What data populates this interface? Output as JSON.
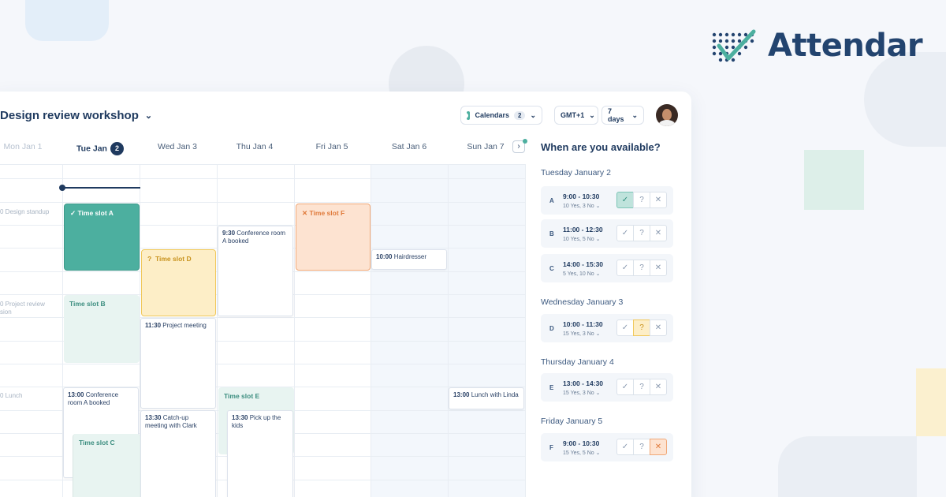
{
  "brand": {
    "name": "Attendar",
    "colors": {
      "primary": "#23446f",
      "accent": "#4caf9f"
    }
  },
  "header": {
    "title": "Design review workshop",
    "calendars_label": "Calendars",
    "calendars_count": "2",
    "timezone": "GMT+1",
    "range": "7 days"
  },
  "days": [
    {
      "label": "Mon Jan 1"
    },
    {
      "label": "Tue Jan",
      "badge": "2"
    },
    {
      "label": "Wed Jan 3"
    },
    {
      "label": "Thu Jan 4"
    },
    {
      "label": "Fri Jan 5"
    },
    {
      "label": "Sat Jan 6"
    },
    {
      "label": "Sun Jan 7"
    }
  ],
  "events": {
    "design_standup": "Design standup",
    "project_review": "Project review",
    "project_review_2": "sion",
    "lunch": "Lunch",
    "conf_room_tue_time": "13:00",
    "conf_room_tue": "Conference room A booked",
    "conf_room_thu_time": "9:30",
    "conf_room_thu": "Conference room A booked",
    "project_meeting_time": "11:30",
    "project_meeting": "Project meeting",
    "catchup_time": "13:30",
    "catchup": "Catch-up meeting with Clark",
    "pickup_time": "13:30",
    "pickup": "Pick up the kids",
    "hairdresser_time": "10:00",
    "hairdresser": "Hairdresser",
    "lunch_linda_time": "13:00",
    "lunch_linda": "Lunch with Linda"
  },
  "slots": {
    "a": "Time slot A",
    "b": "Time slot B",
    "c": "Time slot C",
    "d": "Time slot D",
    "e": "Time slot E",
    "f": "Time slot F",
    "a_mark": "✓",
    "d_mark": "?",
    "f_mark": "✕"
  },
  "panel": {
    "title": "When are you available?",
    "groups": [
      {
        "date": "Tuesday January 2",
        "rows": [
          {
            "letter": "A",
            "time": "9:00 - 10:30",
            "counts": "10 Yes, 3 No ⌄",
            "answer": "yes"
          },
          {
            "letter": "B",
            "time": "11:00 - 12:30",
            "counts": "10 Yes, 5 No ⌄",
            "answer": "none"
          },
          {
            "letter": "C",
            "time": "14:00 - 15:30",
            "counts": "5 Yes, 10 No ⌄",
            "answer": "none"
          }
        ]
      },
      {
        "date": "Wednesday January 3",
        "rows": [
          {
            "letter": "D",
            "time": "10:00 - 11:30",
            "counts": "15 Yes, 3 No ⌄",
            "answer": "maybe"
          }
        ]
      },
      {
        "date": "Thursday January 4",
        "rows": [
          {
            "letter": "E",
            "time": "13:00 - 14:30",
            "counts": "15 Yes, 3 No ⌄",
            "answer": "none"
          }
        ]
      },
      {
        "date": "Friday January 5",
        "rows": [
          {
            "letter": "F",
            "time": "9:00 - 10:30",
            "counts": "15 Yes, 5 No ⌄",
            "answer": "no"
          }
        ]
      }
    ],
    "btn_labels": {
      "yes": "✓",
      "maybe": "?",
      "no": "✕"
    }
  }
}
